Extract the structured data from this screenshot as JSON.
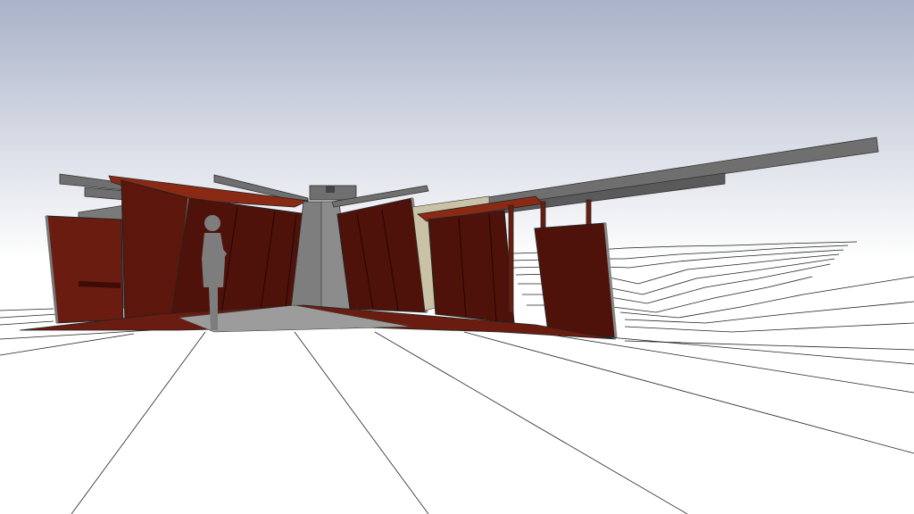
{
  "scene": {
    "kind": "architectural-model-render",
    "sky_top": "#a9b2c8",
    "sky_bottom": "#ffffff",
    "ground": "#ffffff",
    "contour_line": "#222222",
    "rust_dark": "#4f120a",
    "rust_mid": "#6b1c10",
    "rust_roof": "#8a2a14",
    "steel_gray": "#6f6f6f",
    "steel_dark": "#555555",
    "figure_gray": "#7d7d7d"
  }
}
